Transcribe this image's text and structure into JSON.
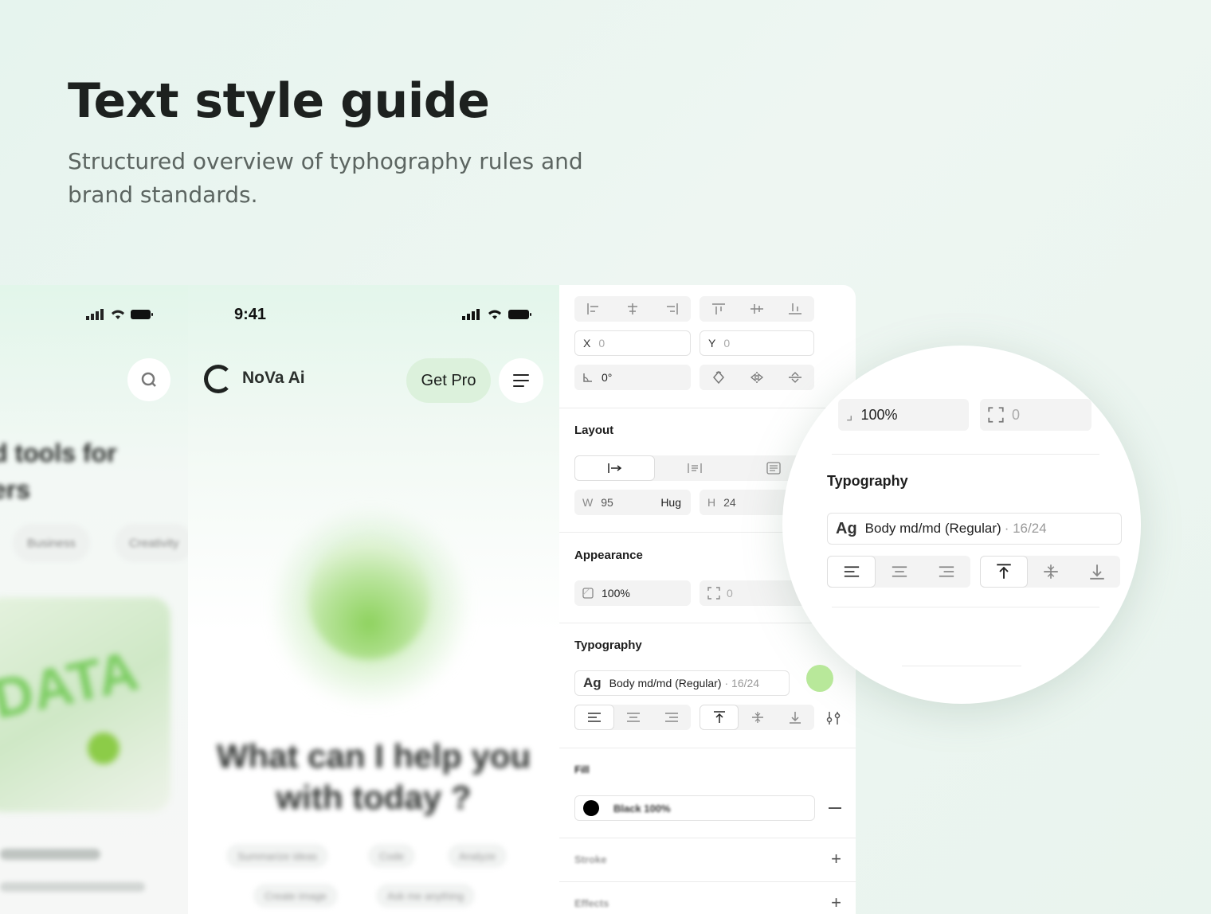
{
  "hero": {
    "title": "Text style guide",
    "subtitle": "Structured overview of typhography rules and brand standards."
  },
  "phone_left": {
    "search_icon": "search-icon",
    "heading_line1": "d tools for",
    "heading_line2": "ers",
    "chips": [
      "Business",
      "Creativity"
    ],
    "card_word": "DATA"
  },
  "phone_main": {
    "time": "9:41",
    "brand": "NoVa Ai",
    "get_pro": "Get Pro",
    "question_line1": "What can I help you",
    "question_line2": "with today ?",
    "suggestions": [
      "Summarize ideas",
      "Code",
      "Analyze",
      "Create image",
      "Ask me anything"
    ]
  },
  "panel": {
    "x_label": "X",
    "x_value": "0",
    "y_label": "Y",
    "y_value": "0",
    "rotation": "0°",
    "layout_title": "Layout",
    "w_label": "W",
    "w_value": "95",
    "w_mode": "Hug",
    "h_label": "H",
    "h_value": "24",
    "appearance_title": "Appearance",
    "opacity": "100%",
    "radius": "0",
    "typography_title": "Typography",
    "ag": "Ag",
    "text_style": "Body md/md (Regular)",
    "text_meta": "· 16/24",
    "fill_title": "Fill",
    "fill_value": "Black 100%",
    "stroke_title": "Stroke",
    "effects_title": "Effects"
  },
  "lens": {
    "opacity": "100%",
    "radius": "0",
    "typography_title": "Typography",
    "ag": "Ag",
    "text_style": "Body md/md (Regular)",
    "text_meta": "· 16/24"
  },
  "colors": {
    "accent": "#dcf1dc",
    "orb": "#8ed25e",
    "background": "#e6f4ee"
  }
}
